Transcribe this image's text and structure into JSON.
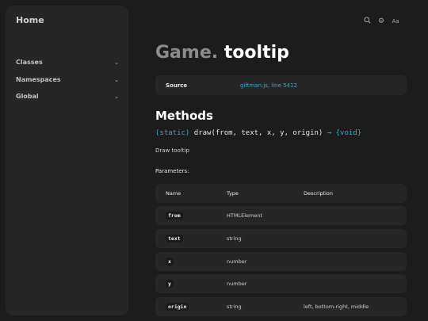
{
  "sidebar": {
    "home": "Home",
    "items": [
      {
        "label": "Classes"
      },
      {
        "label": "Namespaces"
      },
      {
        "label": "Global"
      }
    ]
  },
  "toolbar": {
    "icons": [
      "search-icon",
      "settings-icon",
      "font-size-icon"
    ]
  },
  "page": {
    "namespace": "Game.",
    "name": "tooltip",
    "source_label": "Source",
    "source_link": "giftman.js, line 5412",
    "methods_heading": "Methods",
    "signature": {
      "static": "(static)",
      "call": "draw(from, text, x, y, origin)",
      "arrow": "→",
      "returns": "{void}"
    },
    "description": "Draw tooltip",
    "parameters_label": "Parameters:"
  },
  "params_table": {
    "headers": [
      "Name",
      "Type",
      "Description"
    ],
    "rows": [
      {
        "name": "from",
        "type": "HTMLElement",
        "description": ""
      },
      {
        "name": "text",
        "type": "string",
        "description": ""
      },
      {
        "name": "x",
        "type": "number",
        "description": ""
      },
      {
        "name": "y",
        "type": "number",
        "description": ""
      },
      {
        "name": "origin",
        "type": "string",
        "description": "left, bottom-right, middle"
      }
    ]
  }
}
